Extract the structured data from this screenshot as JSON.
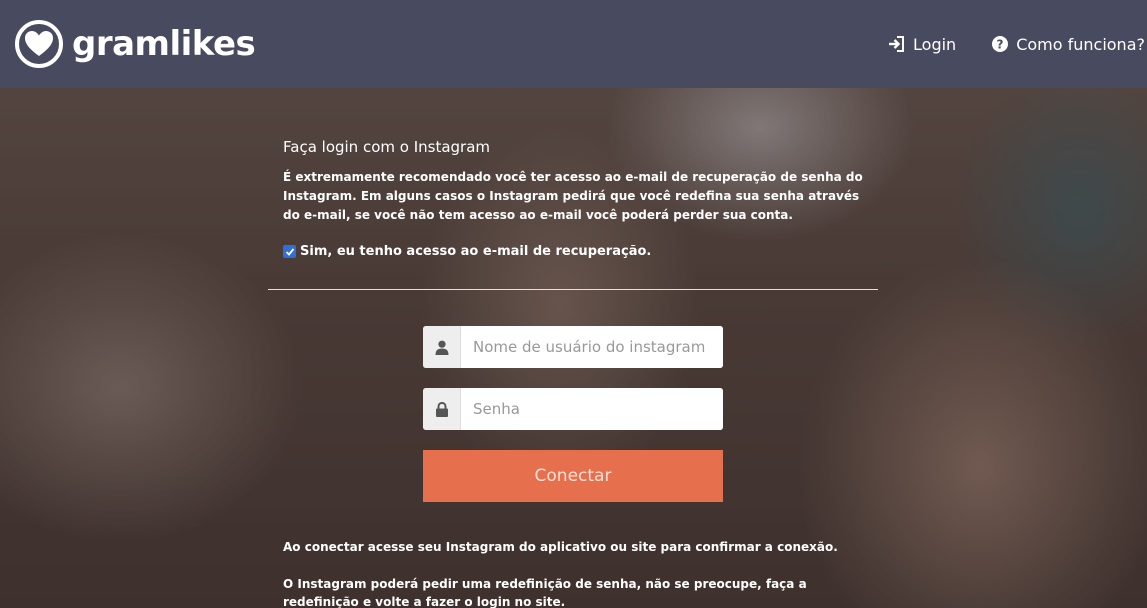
{
  "brand": {
    "name": "gramlikes",
    "icon": "heart-logo-icon"
  },
  "nav": {
    "login": {
      "label": "Login",
      "icon": "sign-in-icon"
    },
    "how": {
      "label": "Como funciona?",
      "icon": "question-circle-icon"
    }
  },
  "login": {
    "title": "Faça login com o Instagram",
    "warning": "É extremamente recomendado você ter acesso ao e-mail de recuperação de senha do Instagram. Em alguns casos o Instagram pedirá que você redefina sua senha através do e-mail, se você não tem acesso ao e-mail você poderá perder sua conta.",
    "checkbox_label": "Sim, eu tenho acesso ao e-mail de recuperação.",
    "checkbox_checked": true,
    "username": {
      "placeholder": "Nome de usuário do instagram",
      "value": "",
      "icon": "user-icon"
    },
    "password": {
      "placeholder": "Senha",
      "value": "",
      "icon": "lock-icon"
    },
    "connect_label": "Conectar",
    "note1": "Ao conectar acesse seu Instagram do aplicativo ou site para confirmar a conexão.",
    "note2": "O Instagram poderá pedir uma redefinição de senha, não se preocupe, faça a redefinição e volte a fazer o login no site."
  },
  "colors": {
    "topbar": "#484a5f",
    "accent": "#e66f4e",
    "checkbox": "#2f6fd6"
  }
}
